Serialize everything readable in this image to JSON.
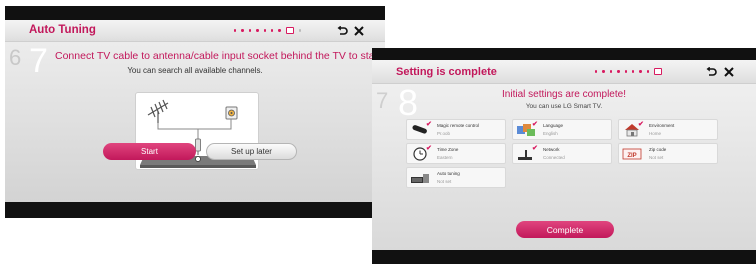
{
  "left_screen": {
    "title": "Auto Tuning",
    "step_number": "7",
    "prev_step_number": "6",
    "next_step_number": "8",
    "instruction_line1": "Connect TV cable to antenna/cable input socket behind the TV to start tuning.",
    "instruction_line2": "You can search all available channels.",
    "start_label": "Start",
    "later_label": "Set up later",
    "back_icon": "back-arrow-icon",
    "close_icon": "close-x-icon"
  },
  "right_screen": {
    "title": "Setting is complete",
    "step_number": "8",
    "prev_step_number": "7",
    "heading": "Initial settings are complete!",
    "subheading": "You can use LG Smart TV.",
    "complete_label": "Complete",
    "back_icon": "back-arrow-icon",
    "close_icon": "close-x-icon",
    "settings": [
      {
        "label": "Magic remote control",
        "value": "Pr.oob",
        "icon": "remote-icon"
      },
      {
        "label": "Language",
        "value": "English",
        "icon": "language-icon"
      },
      {
        "label": "Environment",
        "value": "Home",
        "icon": "home-icon"
      },
      {
        "label": "Time Zone",
        "value": "Eastern",
        "icon": "clock-icon"
      },
      {
        "label": "Network",
        "value": "Connected",
        "icon": "network-icon"
      },
      {
        "label": "Zip code",
        "value": "Not set",
        "icon": "zip-icon"
      },
      {
        "label": "Auto tuning",
        "value": "Not set",
        "icon": "tv-tuning-icon"
      }
    ]
  },
  "colors": {
    "accent": "#c2185b",
    "header_bg": "#e8e8e8",
    "body_bg": "#dedede",
    "frame": "#111111"
  }
}
